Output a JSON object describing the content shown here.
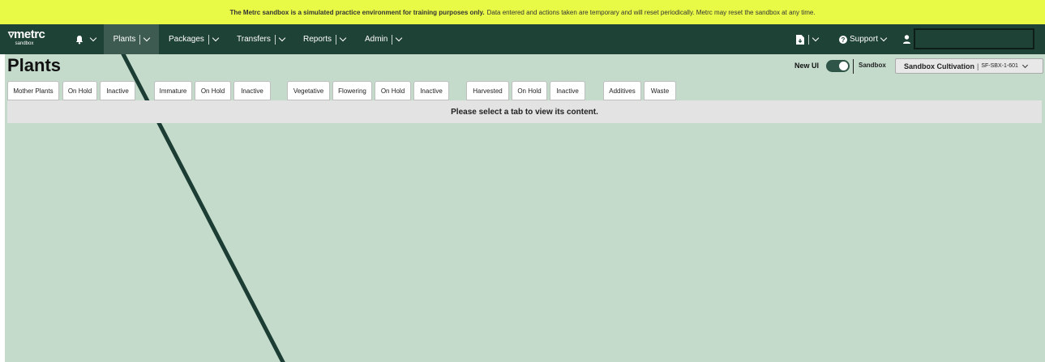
{
  "banner": {
    "bold_text": "The Metrc sandbox is a simulated practice environment for training purposes only.",
    "text": "Data entered and actions taken are temporary and will reset periodically. Metrc may reset the sandbox at any time."
  },
  "navbar": {
    "logo_text": "metrc",
    "logo_sub": "sandbox",
    "items": [
      {
        "label": "Plants",
        "active": true
      },
      {
        "label": "Packages"
      },
      {
        "label": "Transfers"
      },
      {
        "label": "Reports"
      },
      {
        "label": "Admin"
      }
    ],
    "support_label": "Support",
    "search_value": ""
  },
  "page": {
    "title": "Plants",
    "new_ui_label": "New UI",
    "new_ui_on": true,
    "sandbox_label": "Sandbox",
    "facility_name": "Sandbox Cultivation",
    "facility_code": "SF-SBX-1-601",
    "tabs": [
      "Mother Plants",
      "On Hold",
      "Inactive",
      "Immature",
      "On Hold",
      "Inactive",
      "Vegetative",
      "Flowering",
      "On Hold",
      "Inactive",
      "Harvested",
      "On Hold",
      "Inactive",
      "Additives",
      "Waste"
    ],
    "message": "Please select a tab to view its content."
  },
  "colors": {
    "banner": "#e8fa46",
    "navbar": "#1f4237",
    "content_bg": "#c4dbcc"
  }
}
